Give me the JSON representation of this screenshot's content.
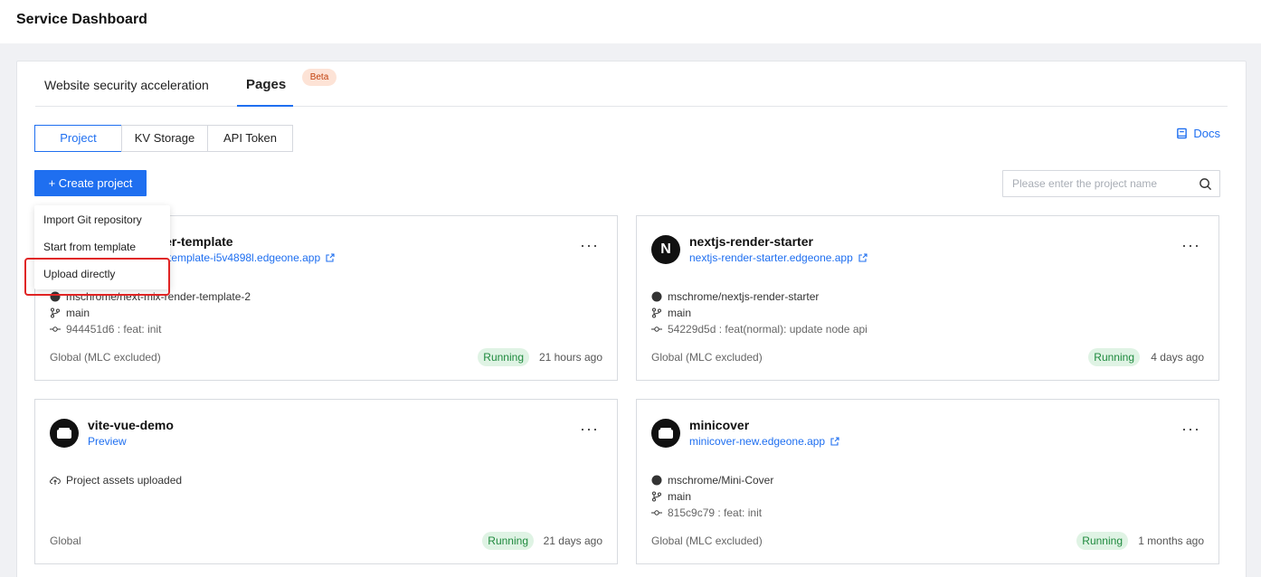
{
  "header": {
    "title": "Service Dashboard"
  },
  "tabs": [
    {
      "label": "Website security acceleration"
    },
    {
      "label": "Pages",
      "badge": "Beta",
      "active": true
    }
  ],
  "subtabs": [
    {
      "label": "Project",
      "active": true
    },
    {
      "label": "KV Storage"
    },
    {
      "label": "API Token"
    }
  ],
  "docs": {
    "label": "Docs"
  },
  "create": {
    "label": "+ Create project"
  },
  "search": {
    "placeholder": "Please enter the project name",
    "value": ""
  },
  "dropdown": {
    "items": [
      {
        "label": "Import Git repository"
      },
      {
        "label": "Start from template"
      },
      {
        "label": "Upload directly",
        "highlighted": true
      }
    ]
  },
  "projects": [
    {
      "name": "nder-template",
      "link": "template-i5v4898l.edgeone.app",
      "repo": "mschrome/next-mix-render-template-2",
      "branch": "main",
      "commit": "944451d6 : feat: init",
      "region": "Global (MLC excluded)",
      "status": "Running",
      "time": "21 hours ago"
    },
    {
      "name": "nextjs-render-starter",
      "logo": "N",
      "link": "nextjs-render-starter.edgeone.app",
      "repo": "mschrome/nextjs-render-starter",
      "branch": "main",
      "commit": "54229d5d : feat(normal): update node api",
      "region": "Global (MLC excluded)",
      "status": "Running",
      "time": "4 days ago"
    },
    {
      "name": "vite-vue-demo",
      "link": "Preview",
      "assets": "Project assets uploaded",
      "region": "Global",
      "status": "Running",
      "time": "21 days ago"
    },
    {
      "name": "minicover",
      "link": "minicover-new.edgeone.app",
      "repo": "mschrome/Mini-Cover",
      "branch": "main",
      "commit": "815c9c79 : feat: init",
      "region": "Global (MLC excluded)",
      "status": "Running",
      "time": "1 months ago"
    }
  ],
  "colors": {
    "accent": "#1f6ff0",
    "running_bg": "#dff3e4",
    "running_text": "#1f8a3e",
    "highlight": "#e02424"
  }
}
